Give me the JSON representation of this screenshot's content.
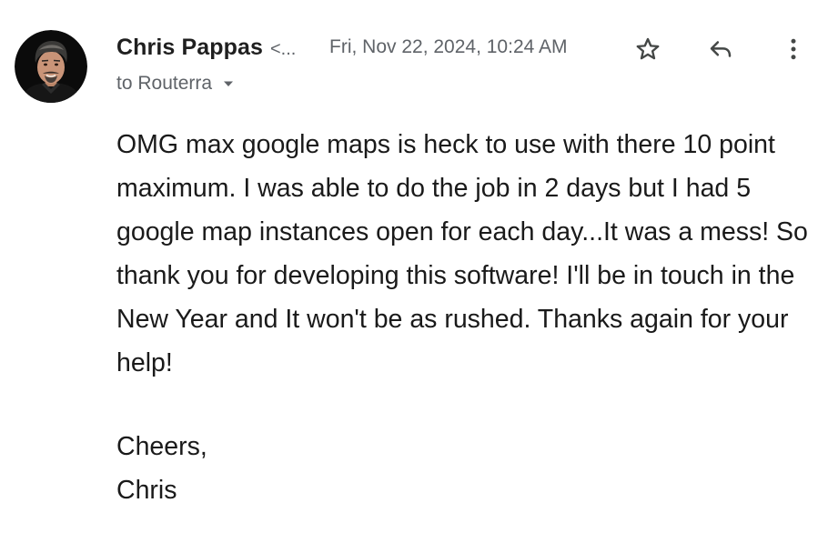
{
  "sender": {
    "name": "Chris Pappas",
    "email_truncated": "<...",
    "avatar_icon": "profile-photo"
  },
  "date": "Fri, Nov 22, 2024, 10:24 AM",
  "recipient": "to Routerra",
  "actions": {
    "star_icon": "star-outline-icon",
    "reply_icon": "reply-icon",
    "more_icon": "more-vert-icon"
  },
  "message": {
    "body": "OMG max google maps is heck to use with there 10 point maximum. I was able to do the job in 2 days but I had 5 google map instances open for each day...It was a mess! So thank you for developing this software! I'll be in touch in the New Year and It won't be as rushed. Thanks again for your help!",
    "closing": "Cheers,",
    "signature": "Chris"
  },
  "colors": {
    "text_primary": "#1f1f1f",
    "text_secondary": "#5f6368",
    "icon": "#444746"
  }
}
